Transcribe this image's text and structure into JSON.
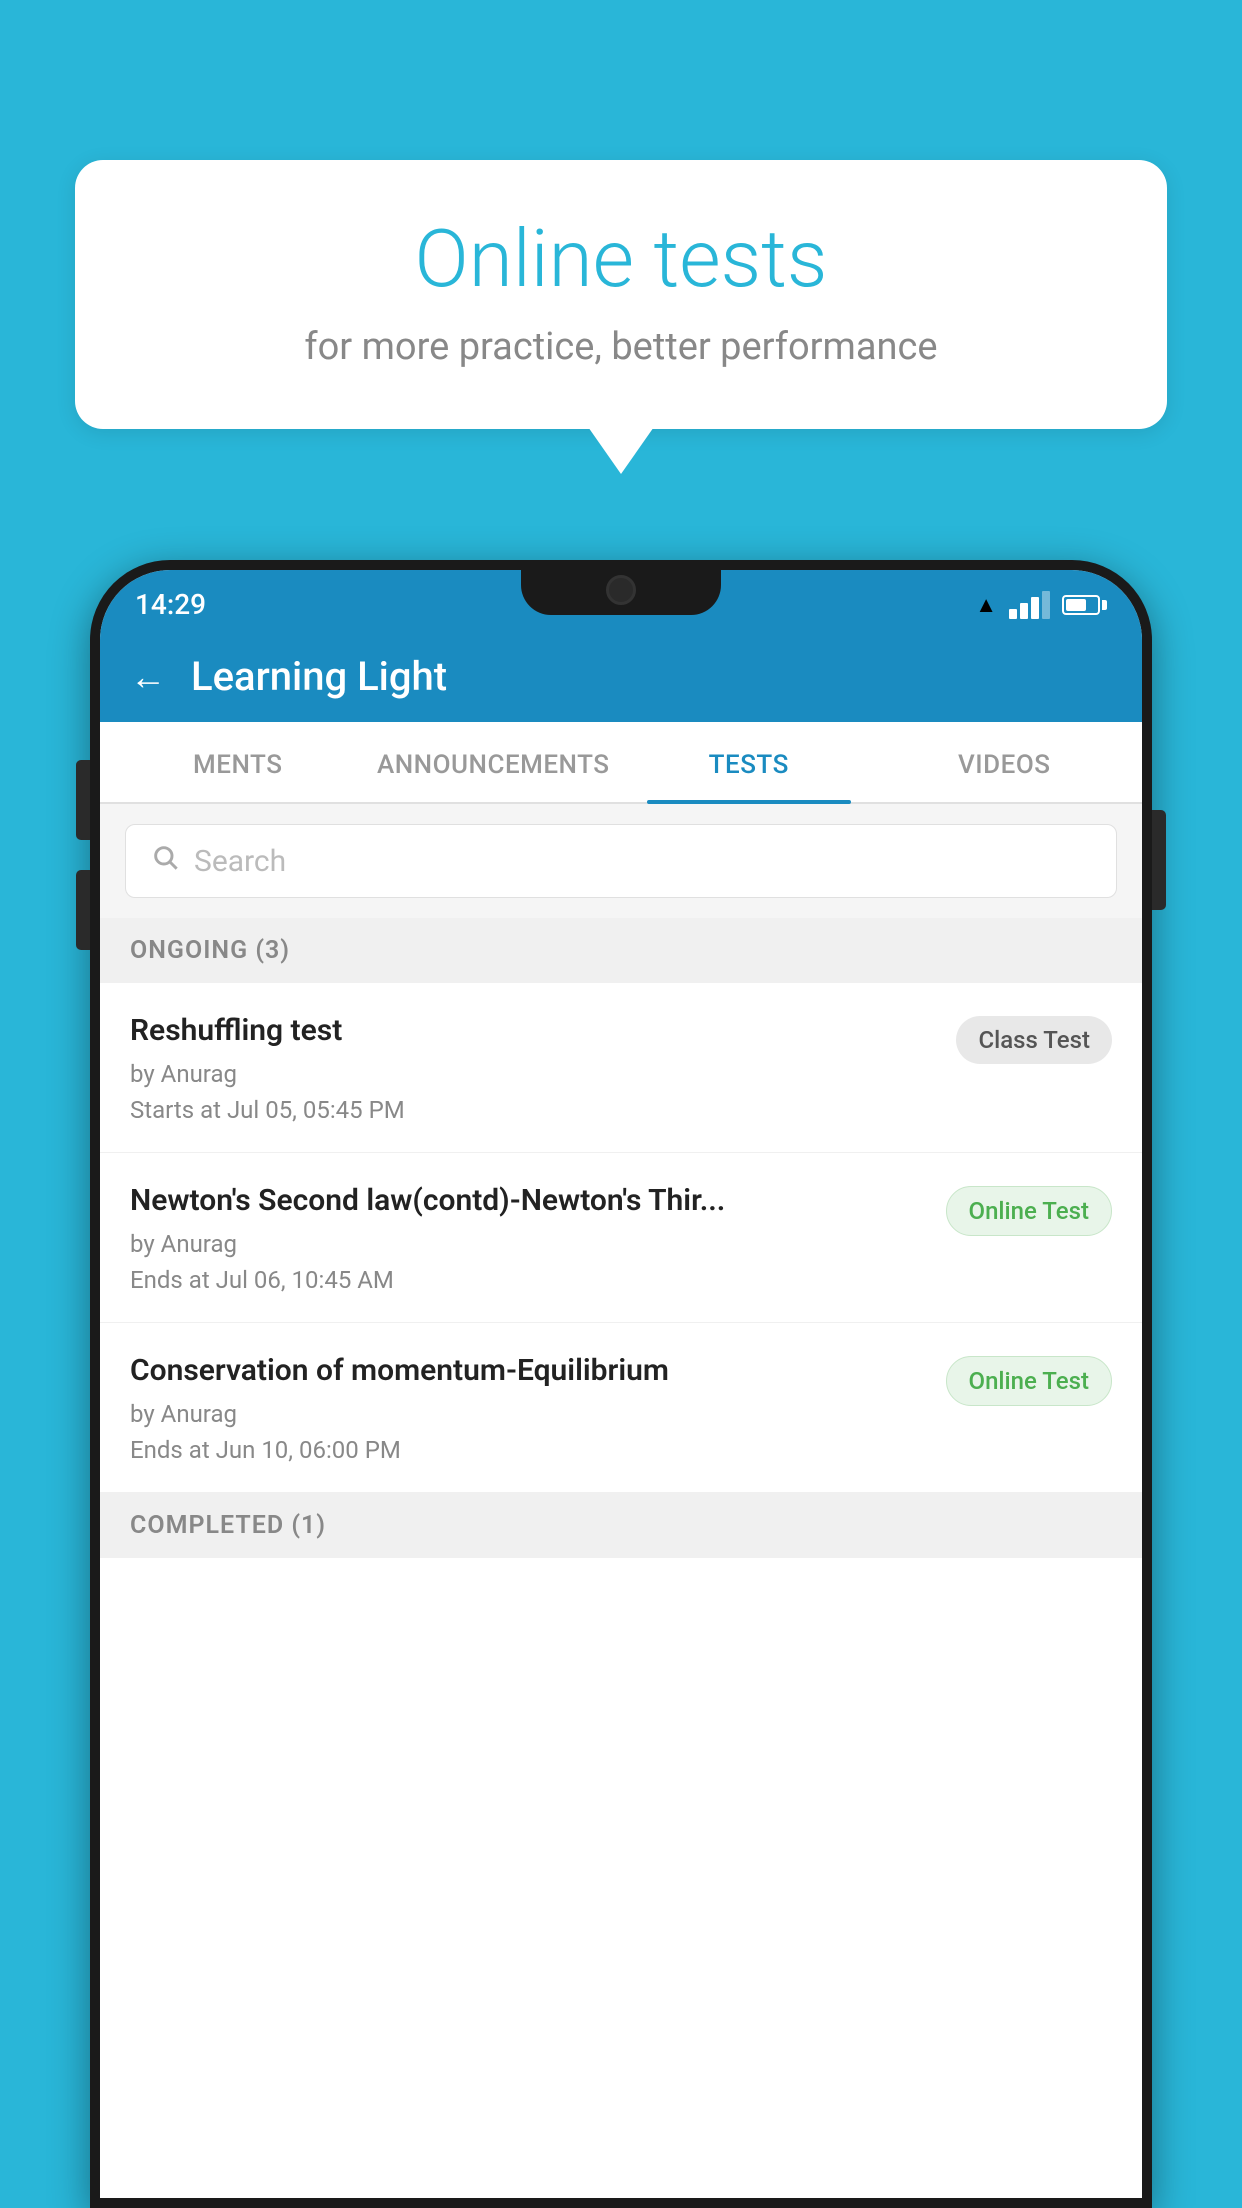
{
  "background_color": "#29b6d8",
  "speech_bubble": {
    "title": "Online tests",
    "subtitle": "for more practice, better performance"
  },
  "phone": {
    "status_bar": {
      "time": "14:29"
    },
    "app_header": {
      "title": "Learning Light",
      "back_icon": "←"
    },
    "tabs": [
      {
        "label": "MENTS",
        "active": false
      },
      {
        "label": "ANNOUNCEMENTS",
        "active": false
      },
      {
        "label": "TESTS",
        "active": true
      },
      {
        "label": "VIDEOS",
        "active": false
      }
    ],
    "search": {
      "placeholder": "Search"
    },
    "ongoing_section": {
      "title": "ONGOING (3)"
    },
    "tests": [
      {
        "name": "Reshuffling test",
        "by": "by Anurag",
        "date_label": "Starts at",
        "date": "Jul 05, 05:45 PM",
        "badge": "Class Test",
        "badge_type": "class"
      },
      {
        "name": "Newton's Second law(contd)-Newton's Thir...",
        "by": "by Anurag",
        "date_label": "Ends at",
        "date": "Jul 06, 10:45 AM",
        "badge": "Online Test",
        "badge_type": "online"
      },
      {
        "name": "Conservation of momentum-Equilibrium",
        "by": "by Anurag",
        "date_label": "Ends at",
        "date": "Jun 10, 06:00 PM",
        "badge": "Online Test",
        "badge_type": "online"
      }
    ],
    "completed_section": {
      "title": "COMPLETED (1)"
    }
  }
}
